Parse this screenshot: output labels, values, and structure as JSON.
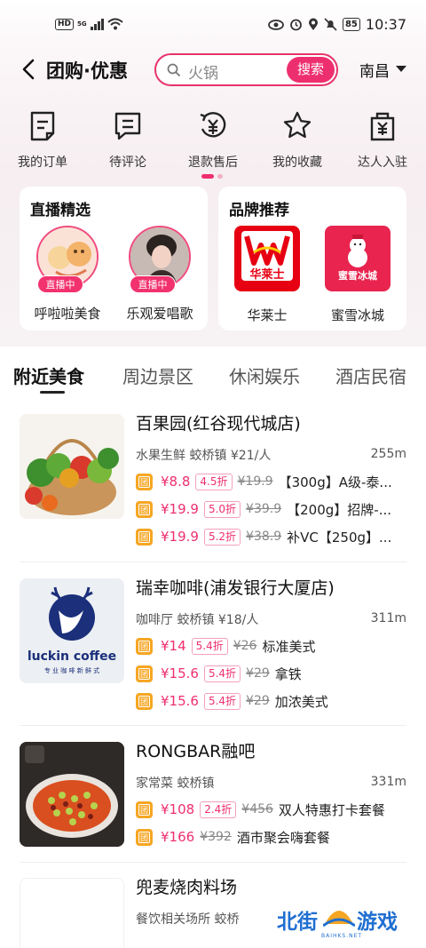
{
  "status": {
    "hd": "HD",
    "net": "5G",
    "battery": "85",
    "time": "10:37"
  },
  "header": {
    "title": "团购·优惠",
    "search_value": "火锅",
    "search_button": "搜索",
    "city": "南昌"
  },
  "quicknav": [
    {
      "label": "我的订单",
      "icon": "order-icon"
    },
    {
      "label": "待评论",
      "icon": "comment-icon"
    },
    {
      "label": "退款售后",
      "icon": "refund-icon"
    },
    {
      "label": "我的收藏",
      "icon": "star-icon"
    },
    {
      "label": "达人入驻",
      "icon": "shop-bag-icon"
    }
  ],
  "live_card": {
    "title": "直播精选",
    "badge": "直播中",
    "items": [
      {
        "name": "呼啦啦美食"
      },
      {
        "name": "乐观爱唱歌"
      }
    ]
  },
  "brand_card": {
    "title": "品牌推荐",
    "items": [
      {
        "name": "华莱士",
        "logo_text": "华莱士"
      },
      {
        "name": "蜜雪冰城",
        "logo_text": "蜜雪冰城"
      }
    ]
  },
  "tabs": [
    "附近美食",
    "周边景区",
    "休闲娱乐",
    "酒店民宿"
  ],
  "listings": [
    {
      "name": "百果园(红谷现代城店)",
      "meta": "水果生鲜  蛟桥镇  ¥21/人",
      "distance": "255m",
      "deals": [
        {
          "price": "¥8.8",
          "discount": "4.5折",
          "original": "¥19.9",
          "title": "【300g】A级-泰..."
        },
        {
          "price": "¥19.9",
          "discount": "5.0折",
          "original": "¥39.9",
          "title": "【200g】招牌-..."
        },
        {
          "price": "¥19.9",
          "discount": "5.2折",
          "original": "¥38.9",
          "title": "补VC【250g】..."
        }
      ]
    },
    {
      "name": "瑞幸咖啡(浦发银行大厦店)",
      "meta": "咖啡厅  蛟桥镇  ¥18/人",
      "distance": "311m",
      "logo_text": "luckin coffee",
      "logo_sub": "专 业 咖 啡 新 鲜 式",
      "deals": [
        {
          "price": "¥14",
          "discount": "5.4折",
          "original": "¥26",
          "title": "标准美式"
        },
        {
          "price": "¥15.6",
          "discount": "5.4折",
          "original": "¥29",
          "title": "拿铁"
        },
        {
          "price": "¥15.6",
          "discount": "5.4折",
          "original": "¥29",
          "title": "加浓美式"
        }
      ]
    },
    {
      "name": "RONGBAR融吧",
      "meta": "家常菜  蛟桥镇",
      "distance": "331m",
      "deals": [
        {
          "price": "¥108",
          "discount": "2.4折",
          "original": "¥456",
          "title": "双人特惠打卡套餐"
        },
        {
          "price": "¥166",
          "discount": "",
          "original": "¥392",
          "title": "酒市聚会嗨套餐"
        }
      ]
    },
    {
      "name": "兜麦烧肉料场",
      "meta": "餐饮相关场所  蛟桥",
      "distance": "",
      "deals": []
    }
  ],
  "tuan_label": "团",
  "watermark": {
    "text1": "北街",
    "text2": "游戏",
    "sub": "BAIHKS.NET"
  },
  "colors": {
    "accent": "#ee2f6f",
    "tuan": "#f6a623"
  }
}
